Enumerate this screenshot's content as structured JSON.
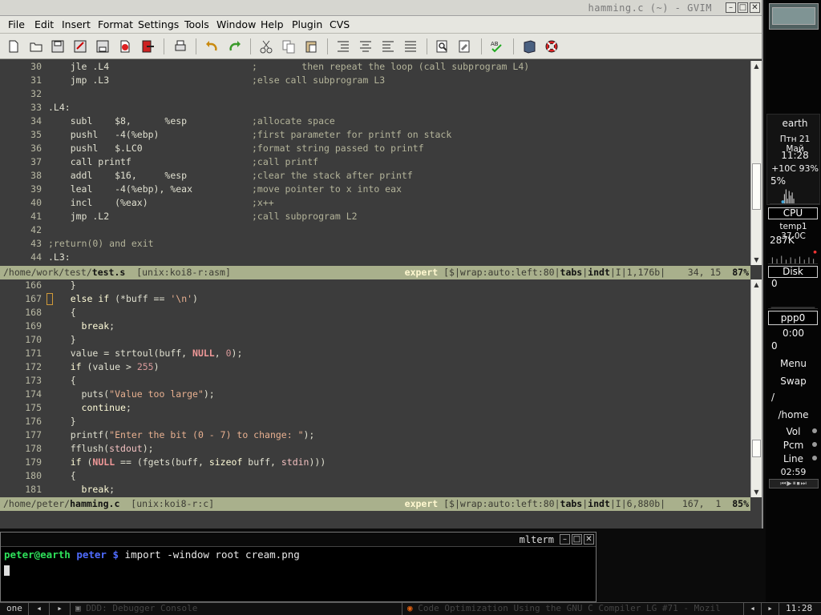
{
  "gvim": {
    "title": "hamming.c (~) - GVIM",
    "menu": [
      "File",
      "Edit",
      "Insert",
      "Format",
      "Settings",
      "Tools",
      "Window",
      "Help",
      "Plugin",
      "CVS"
    ],
    "toolbar_icons": [
      "new-file-icon",
      "open-folder-icon",
      "save-icon",
      "save-all-icon",
      "print-preview-icon",
      "close-file-icon",
      "exit-icon",
      "print-icon",
      "undo-icon",
      "redo-icon",
      "cut-icon",
      "copy-icon",
      "paste-icon",
      "indent-icon",
      "center-icon",
      "outdent-icon",
      "justify-icon",
      "find-icon",
      "find-replace-icon",
      "spellcheck-icon",
      "book-icon",
      "help-lifebuoy-icon"
    ],
    "top_pane": {
      "lines": [
        {
          "n": "30",
          "code": "    jle .L4",
          "comment": ";        then repeat the loop (call subprogram L4)"
        },
        {
          "n": "31",
          "code": "    jmp .L3",
          "comment": ";else call subprogram L3"
        },
        {
          "n": "32",
          "code": "",
          "comment": ""
        },
        {
          "n": "33",
          "code": ".L4:",
          "comment": ""
        },
        {
          "n": "34",
          "code": "    subl    $8,      %esp",
          "comment": ";allocate space"
        },
        {
          "n": "35",
          "code": "    pushl   -4(%ebp)",
          "comment": ";first parameter for printf on stack"
        },
        {
          "n": "36",
          "code": "    pushl   $.LC0",
          "comment": ";format string passed to printf"
        },
        {
          "n": "37",
          "code": "    call printf",
          "comment": ";call printf"
        },
        {
          "n": "38",
          "code": "    addl    $16,     %esp",
          "comment": ";clear the stack after printf"
        },
        {
          "n": "39",
          "code": "    leal    -4(%ebp), %eax",
          "comment": ";move pointer to x into eax"
        },
        {
          "n": "40",
          "code": "    incl    (%eax)",
          "comment": ";x++"
        },
        {
          "n": "41",
          "code": "    jmp .L2",
          "comment": ";call subprogram L2"
        },
        {
          "n": "42",
          "code": "",
          "comment": ""
        },
        {
          "n": "43",
          "code": "",
          "comment": ";return(0) and exit"
        },
        {
          "n": "44",
          "code": ".L3:",
          "comment": ""
        }
      ],
      "status": {
        "path_prefix": "/home/work/test/",
        "file": "test.s",
        "format": "[unix:koi8-r:asm]",
        "mode": "expert",
        "flags": "[$|wrap:auto:left:80|",
        "tabs": "tabs",
        "sep": "|",
        "indt": "indt",
        "info": "|I|1,176b|    34, 15",
        "percent": "87%"
      }
    },
    "bottom_pane": {
      "status": {
        "path_prefix": "/home/peter/",
        "file": "hamming.c",
        "format": "[unix:koi8-r:c]",
        "mode": "expert",
        "flags": "[$|wrap:auto:left:80|",
        "tabs": "tabs",
        "sep": "|",
        "indt": "indt",
        "info": "|I|6,880b|   167,  1",
        "percent": "85%"
      }
    }
  },
  "code_c": {
    "l166": "    }",
    "l167_a": "    ",
    "l167_kw": "else if",
    "l167_b": " (*buff == ",
    "l167_str": "'\\n'",
    "l167_c": ")",
    "l168": "    {",
    "l169_a": "      ",
    "l169_kw": "break",
    "l169_b": ";",
    "l170": "    }",
    "l171_a": "    value = strtoul(buff, ",
    "l171_cst": "NULL",
    "l171_b": ", ",
    "l171_num": "0",
    "l171_c": ");",
    "l172_a": "    ",
    "l172_kw": "if",
    "l172_b": " (value > ",
    "l172_num": "255",
    "l172_c": ")",
    "l173": "    {",
    "l174_a": "      puts(",
    "l174_str": "\"Value too large\"",
    "l174_b": ");",
    "l175_a": "      ",
    "l175_kw": "continue",
    "l175_b": ";",
    "l176": "    }",
    "l177_a": "    printf(",
    "l177_str": "\"Enter the bit (0 - 7) to change: \"",
    "l177_b": ");",
    "l178_a": "    fflush(",
    "l178_std": "stdout",
    "l178_b": ");",
    "l179_a": "    ",
    "l179_kw": "if",
    "l179_b": " (",
    "l179_cst": "NULL",
    "l179_c": " == (fgets(buff, ",
    "l179_kw2": "sizeof",
    "l179_d": " buff, ",
    "l179_std": "stdin",
    "l179_e": ")))",
    "l180": "    {",
    "l181_a": "      ",
    "l181_kw": "break",
    "l181_b": ";",
    "numbers": [
      "166",
      "167",
      "168",
      "169",
      "170",
      "171",
      "172",
      "173",
      "174",
      "175",
      "176",
      "177",
      "178",
      "179",
      "180",
      "181"
    ]
  },
  "mlterm": {
    "title": "mlterm",
    "prompt_user": "peter@earth",
    "prompt_dir": "peter $",
    "command": " import -window root cream.png"
  },
  "taskbar": {
    "workspace": "one",
    "task1": "DDD: Debugger Console",
    "task2": "Code Optimization Using the GNU C Compiler LG #71 - Mozil",
    "clock": "11:28"
  },
  "dock": {
    "host": "earth",
    "date": "Птн 21 Май",
    "time": "11:28",
    "weather": "+10C 93%",
    "load": "5%",
    "cpu_label": "CPU",
    "temp": "temp1 37.0C",
    "mem": "287K",
    "disk_label": "Disk",
    "disk_val": "0",
    "net_label": "ppp0",
    "net_time": "0:00",
    "net_val": "0",
    "menu": "Menu",
    "swap": "Swap",
    "root": "/",
    "home": "/home",
    "vol": "Vol",
    "pcm": "Pcm",
    "line": "Line",
    "track_time": "02:59"
  }
}
